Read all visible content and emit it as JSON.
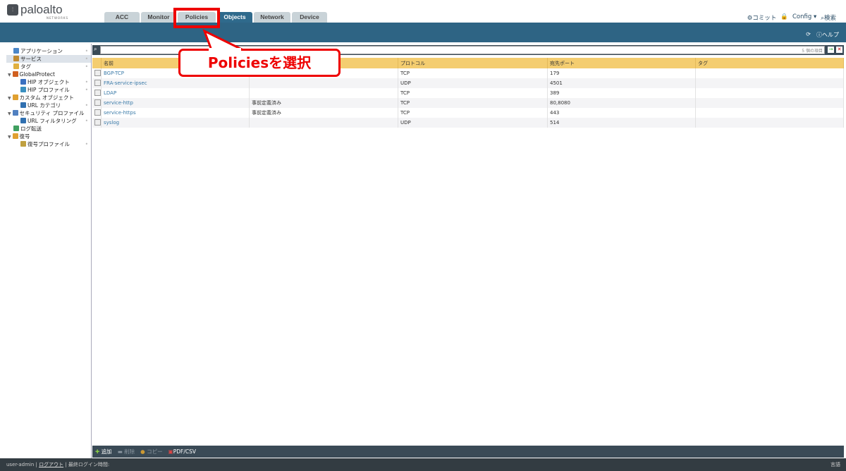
{
  "header": {
    "logo": "paloalto",
    "logo_sub": "NETWORKS",
    "tabs": [
      "ACC",
      "Monitor",
      "Policies",
      "Objects",
      "Network",
      "Device"
    ],
    "active_tab": "Objects",
    "commit": "コミット",
    "config": "Config",
    "search": "検索",
    "help": "ヘルプ"
  },
  "sidebar": {
    "items": [
      {
        "label": "アプリケーション",
        "indent": 0,
        "color": "#4a86c8"
      },
      {
        "label": "サービス",
        "indent": 0,
        "color": "#c08a30",
        "selected": true
      },
      {
        "label": "タグ",
        "indent": 0,
        "color": "#e0b040"
      },
      {
        "label": "GlobalProtect",
        "indent": 0,
        "color": "#d06020",
        "expand": true
      },
      {
        "label": "HIP オブジェクト",
        "indent": 1,
        "color": "#3a70c0"
      },
      {
        "label": "HIP プロファイル",
        "indent": 1,
        "color": "#3a90c0"
      },
      {
        "label": "カスタム オブジェクト",
        "indent": 0,
        "color": "#e0a030",
        "expand": true
      },
      {
        "label": "URL カテゴリ",
        "indent": 1,
        "color": "#3070b0"
      },
      {
        "label": "セキュリティ プロファイル",
        "indent": 0,
        "color": "#5080c0",
        "expand": true
      },
      {
        "label": "URL フィルタリング",
        "indent": 1,
        "color": "#3070b0"
      },
      {
        "label": "ログ転送",
        "indent": 0,
        "color": "#40a060"
      },
      {
        "label": "復号",
        "indent": 0,
        "color": "#e0a030",
        "expand": true
      },
      {
        "label": "復号プロファイル",
        "indent": 1,
        "color": "#c0a040"
      }
    ]
  },
  "search": {
    "count": "5 個の項目"
  },
  "table": {
    "headers": [
      "名前",
      "",
      "プロトコル",
      "宛先ポート",
      "タグ"
    ],
    "rows": [
      [
        "BGP-TCP",
        "",
        "TCP",
        "179",
        ""
      ],
      [
        "FRA-service-ipsec",
        "",
        "UDP",
        "4501",
        ""
      ],
      [
        "LDAP",
        "",
        "TCP",
        "389",
        ""
      ],
      [
        "service-http",
        "事前定義済み",
        "TCP",
        "80,8080",
        ""
      ],
      [
        "service-https",
        "事前定義済み",
        "TCP",
        "443",
        ""
      ],
      [
        "syslog",
        "",
        "UDP",
        "514",
        ""
      ]
    ]
  },
  "toolbar": {
    "add": "追加",
    "delete": "削除",
    "copy": "コピー",
    "pdf": "PDF/CSV"
  },
  "status": {
    "user": "user-admin",
    "logout": "ログアウト",
    "last_login": "最終ログイン時間:",
    "language": "言語"
  },
  "annotation": {
    "callout": "Policiesを選択"
  }
}
